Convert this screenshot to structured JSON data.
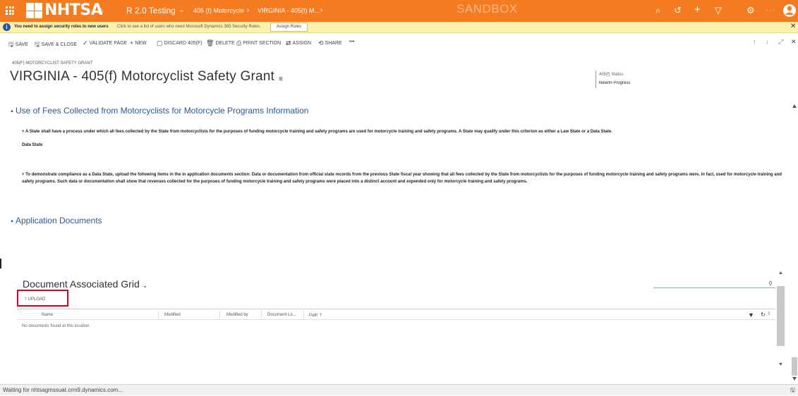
{
  "colors": {
    "accent": "#f47b20",
    "link": "#2b5797",
    "notification_bg": "#fbf1ac",
    "highlight": "#e2001a"
  },
  "topbar": {
    "logo_text": "NHTSA",
    "app_name": "R 2.0 Testing",
    "breadcrumbs": [
      "405 (f) Motorcycle",
      "VIRGINIA - 405(f) M..."
    ],
    "environment": "SANDBOX",
    "icons": [
      "search-icon",
      "history-icon",
      "plus-icon",
      "filter-icon",
      "gear-icon",
      "ellipsis-icon",
      "user-avatar-icon"
    ]
  },
  "notification": {
    "message": "You need to assign security roles to new users",
    "detail": "Click to see a list of users who need Microsoft Dynamics 365 Security Roles.",
    "button": "Assign Roles"
  },
  "commands": {
    "save": "SAVE",
    "save_close": "SAVE & CLOSE",
    "validate": "VALIDATE PAGE",
    "new": "NEW",
    "discard": "DISCARD 405(F)",
    "delete": "DELETE",
    "print": "PRINT SECTION",
    "assign": "ASSIGN",
    "share": "SHARE",
    "more": "•••"
  },
  "record": {
    "entity_type": "405(F) MOTORCYCLIST SAFETY GRANT",
    "title": "VIRGINIA - 405(f) Motorcyclist Safety Grant",
    "status_label": "405(f) Status",
    "status_value": "New/In Progress"
  },
  "sections": {
    "fees_title": "Use of Fees Collected from Motorcyclists for Motorcycle Programs Information",
    "fees_para1": "+ A State shall have a process under which all fees collected by the State from motorcyclists for the purposes of funding motorcycle training and safety programs are used for motorcycle training and safety programs. A State may qualify under this criterion as either a Law State or a Data State.",
    "fees_data_state": "Data State",
    "fees_para2": "+ To demonstrate compliance as a Data State, upload the following items in the in application documents section: Data or documentation from official state records from the previous State fiscal year showing that all fees collected by the State from motorcyclists for the purposes of funding motorcycle training and safety programs were, in fact, used for motorcycle training and safety programs. Such data or documentation shall show that revenues collected for the purposes of funding motorcycle training and safety programs were placed into a distinct account and expended only for motorcycle training and safety programs.",
    "docs_title": "Application Documents"
  },
  "grid": {
    "title": "Document Associated Grid",
    "upload": "UPLOAD",
    "columns": [
      "Name",
      "Modified",
      "Modified by",
      "Document Lo...",
      "Path"
    ],
    "empty": "No documents found at this location."
  },
  "statusbar": {
    "text": "Waiting for nhtsagmssuat.crm9.dynamics.com..."
  }
}
